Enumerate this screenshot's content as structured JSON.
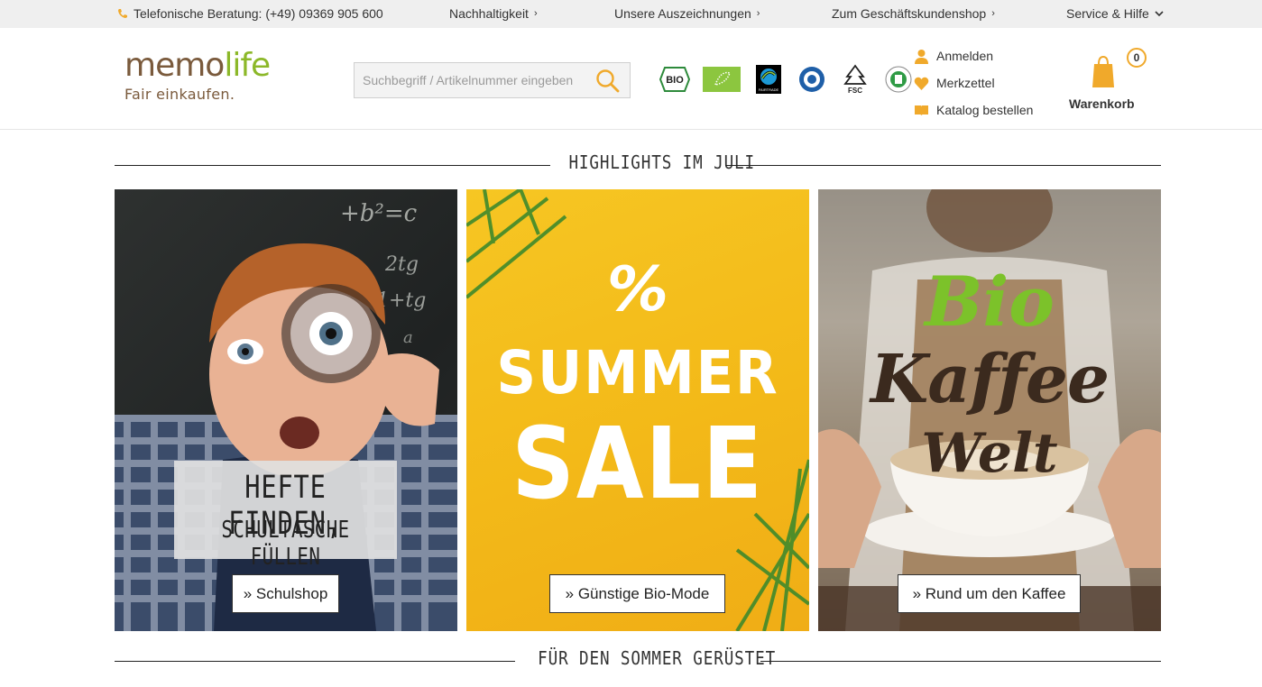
{
  "topbar": {
    "phone": "Telefonische Beratung: (+49) 09369 905 600",
    "sustainability": "Nachhaltigkeit",
    "awards": "Unsere Auszeichnungen",
    "business": "Zum Geschäftskundenshop",
    "service": "Service & Hilfe"
  },
  "logo": {
    "memo": "memo",
    "life": "life",
    "tagline": "Fair einkaufen."
  },
  "search": {
    "placeholder": "Suchbegriff / Artikelnummer eingeben"
  },
  "seals": [
    {
      "icon": "bio-seal-icon",
      "text": "BIO"
    },
    {
      "icon": "eu-organic-leaf-icon"
    },
    {
      "icon": "fairtrade-icon"
    },
    {
      "icon": "blue-angel-icon"
    },
    {
      "icon": "fsc-icon",
      "text": "FSC"
    },
    {
      "icon": "gots-icon"
    }
  ],
  "usermenu": {
    "login": "Anmelden",
    "wishlist": "Merkzettel",
    "catalog": "Katalog bestellen"
  },
  "cart": {
    "label": "Warenkorb",
    "count": "0"
  },
  "sections": {
    "highlights": "HIGHLIGHTS IM JULI",
    "summer": "FÜR DEN SOMMER GERÜSTET"
  },
  "tiles": {
    "school": {
      "headline1": "HEFTE FINDEN,",
      "headline2": "SCHULTASCHE FÜLLEN",
      "cta": "» Schulshop"
    },
    "sale": {
      "pct": "%",
      "summer": "SUMMER",
      "sale": "SALE",
      "cta": "» Günstige Bio-Mode"
    },
    "coffee": {
      "bio": "Bio",
      "kaffee": "Kaffee",
      "welt": "Welt",
      "cta": "» Rund um den Kaffee"
    }
  },
  "colors": {
    "brand_brown": "#7a5a3c",
    "brand_green": "#8cb829",
    "accent_orange": "#f0a92b",
    "topbar_bg": "#efefef"
  }
}
